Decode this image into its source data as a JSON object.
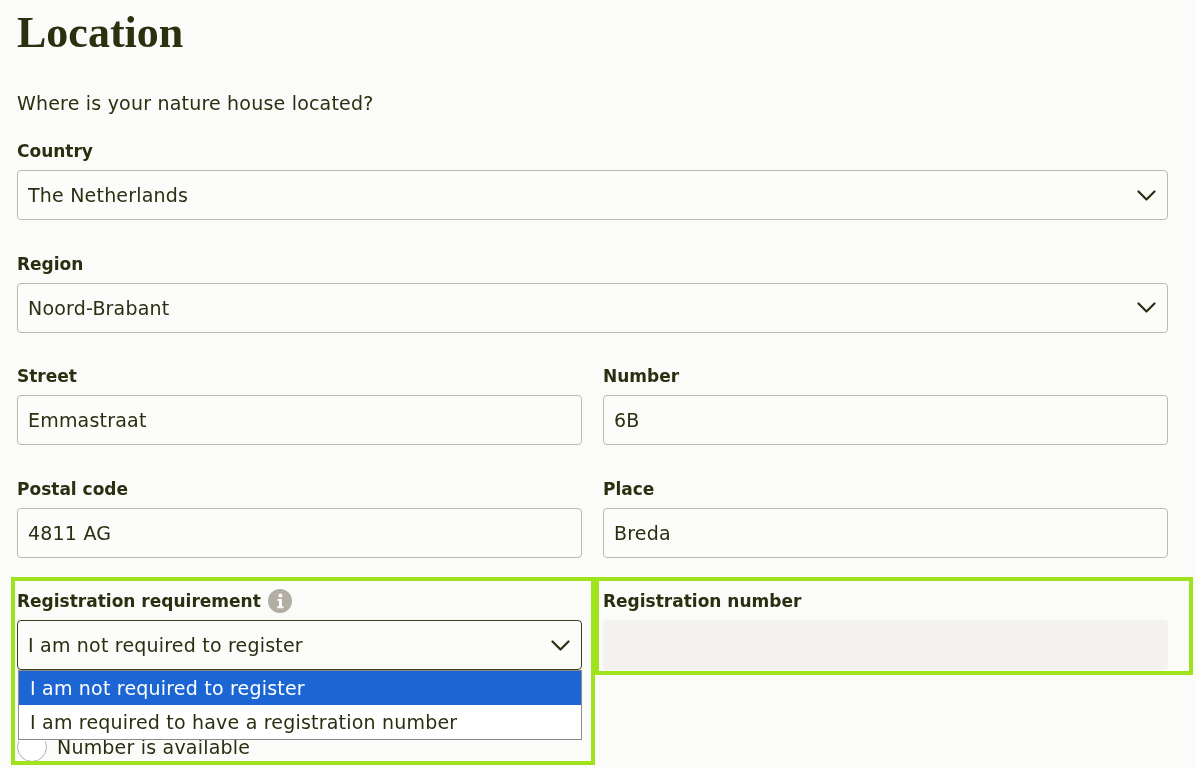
{
  "heading": "Location",
  "intro": "Where is your nature house located?",
  "rows": [
    [
      {
        "kind": "select",
        "label": "Country",
        "value": "The Netherlands",
        "expanded": false,
        "highlighted": false
      }
    ],
    [
      {
        "kind": "select",
        "label": "Region",
        "value": "Noord-Brabant",
        "expanded": false,
        "highlighted": false
      }
    ],
    [
      {
        "kind": "text",
        "label": "Street",
        "value": "Emmastraat",
        "disabled": false,
        "highlighted": false
      },
      {
        "kind": "text",
        "label": "Number",
        "value": "6B",
        "disabled": false,
        "highlighted": false
      }
    ],
    [
      {
        "kind": "text",
        "label": "Postal code",
        "value": "4811 AG",
        "disabled": false,
        "highlighted": false
      },
      {
        "kind": "text",
        "label": "Place",
        "value": "Breda",
        "disabled": false,
        "highlighted": false
      }
    ],
    [
      {
        "kind": "select",
        "label": "Registration requirement",
        "info": true,
        "value": "I am not required to register",
        "expanded": true,
        "highlighted": true,
        "options": [
          {
            "label": "I am not required to register",
            "selected": true
          },
          {
            "label": "I am required to have a registration number",
            "selected": false
          }
        ],
        "radios": [
          {
            "label": "Number is available",
            "checked": false
          }
        ]
      },
      {
        "kind": "text",
        "label": "Registration number",
        "disabled": true,
        "highlighted": true
      }
    ]
  ]
}
